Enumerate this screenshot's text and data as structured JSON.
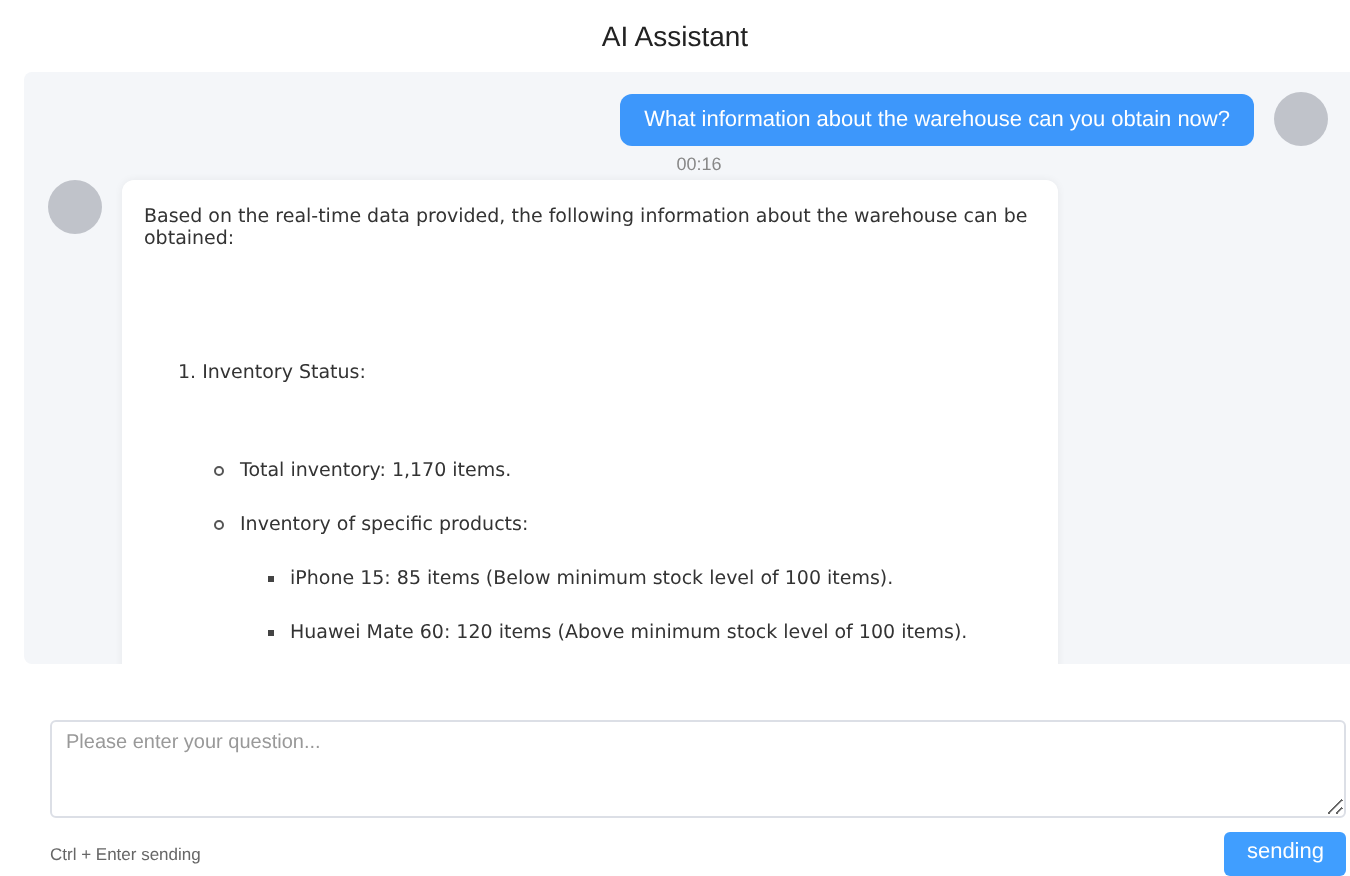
{
  "title": "AI Assistant",
  "messages": [
    {
      "kind": "user",
      "text": "What information about the warehouse can you obtain now?",
      "time": "00:16"
    },
    {
      "kind": "bot",
      "intro": "Based on the real-time data provided, the following information about the warehouse can be obtained:",
      "items": [
        {
          "text": "1. Inventory Status:",
          "kind": "numbered",
          "children": [
            {
              "text": "Total inventory: 1,170 items.",
              "kind": "circle"
            },
            {
              "text": "Inventory of specific products:",
              "kind": "circle",
              "children": [
                {
                  "text": "iPhone 15: 85 items (Below minimum stock level of 100 items).",
                  "kind": "square"
                },
                {
                  "text": "Huawei Mate 60: 120 items (Above minimum stock level of 100 items).",
                  "kind": "square"
                }
              ]
            }
          ]
        }
      ]
    }
  ],
  "input": {
    "placeholder": "Please enter your question..."
  },
  "hint": "Ctrl + Enter sending",
  "send_button": "sending"
}
